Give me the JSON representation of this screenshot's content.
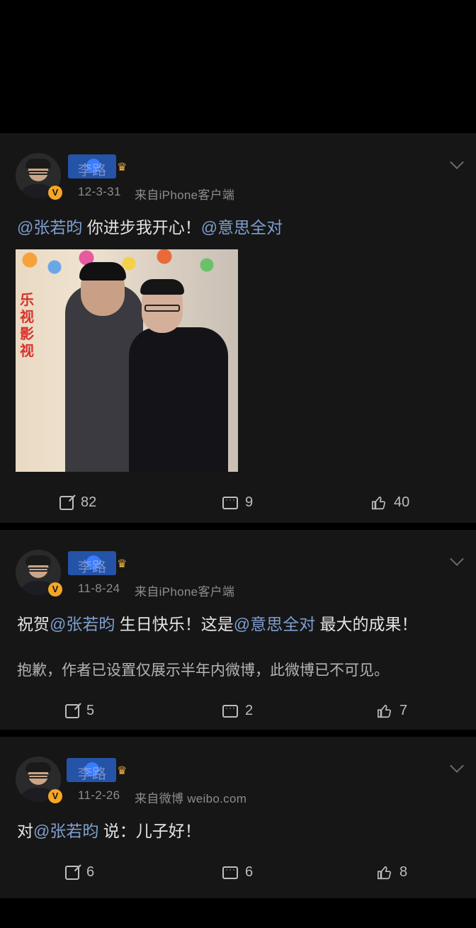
{
  "posts": [
    {
      "author": "李路",
      "time": "12-3-31",
      "source": "来自iPhone客户端",
      "segments": [
        {
          "text": "@张若昀",
          "mention": true
        },
        {
          "text": " 你进步我开心！",
          "mention": false
        },
        {
          "text": "@意思全对",
          "mention": true
        }
      ],
      "photo_text": "乐视影视",
      "stats": {
        "share": "82",
        "comment": "9",
        "like": "40"
      }
    },
    {
      "author": "李路",
      "time": "11-8-24",
      "source": "来自iPhone客户端",
      "segments": [
        {
          "text": "祝贺",
          "mention": false
        },
        {
          "text": "@张若昀",
          "mention": true
        },
        {
          "text": " 生日快乐！这是",
          "mention": false
        },
        {
          "text": "@意思全对",
          "mention": true
        },
        {
          "text": " 最大的成果！",
          "mention": false
        }
      ],
      "notice": "抱歉，作者已设置仅展示半年内微博，此微博已不可见。",
      "stats": {
        "share": "5",
        "comment": "2",
        "like": "7"
      }
    },
    {
      "author": "李路",
      "time": "11-2-26",
      "source": "来自微博 weibo.com",
      "segments": [
        {
          "text": "对",
          "mention": false
        },
        {
          "text": "@张若昀",
          "mention": true
        },
        {
          "text": " 说：儿子好！",
          "mention": false
        }
      ],
      "stats": {
        "share": "6",
        "comment": "6",
        "like": "8"
      }
    }
  ],
  "icons": {
    "share": "share-icon",
    "comment": "comment-icon",
    "like": "like-icon",
    "verified": "verified-badge",
    "crown": "crown-icon",
    "more": "chevron-down-icon"
  },
  "colors": {
    "background": "#000000",
    "card": "#161616",
    "mention": "#7f9fcf",
    "meta": "#8c8c8c",
    "badge": "#f5a623"
  }
}
